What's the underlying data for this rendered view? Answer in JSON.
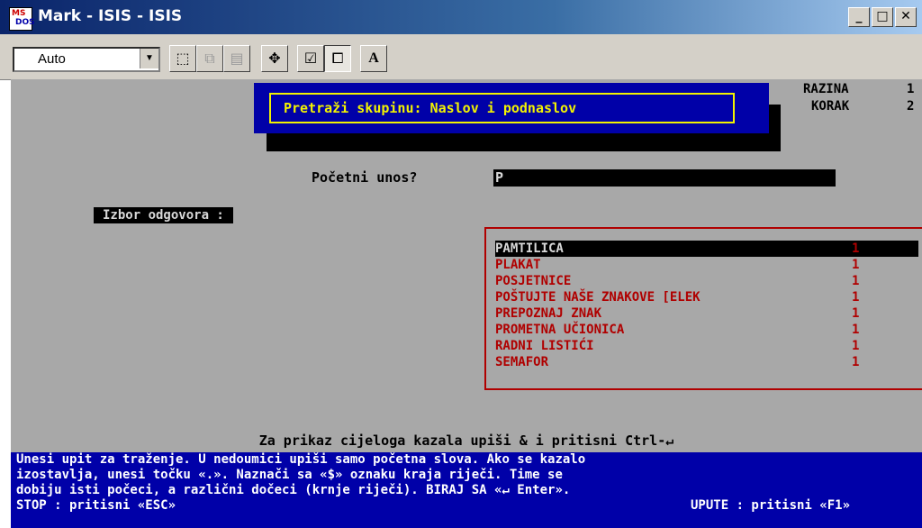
{
  "window": {
    "title": "Mark - ISIS - ISIS",
    "logo_top": "MS",
    "logo_bottom": "DOS",
    "minimize": "_",
    "maximize": "□",
    "close": "✕"
  },
  "toolbar": {
    "font_select_value": "Auto",
    "font_bold_label": "A"
  },
  "popup": {
    "title": "Pretraži skupinu: Naslov i podnaslov"
  },
  "status": {
    "razina_label": "RAZINA",
    "razina_value": "1",
    "korak_label": "KORAK",
    "korak_value": "2"
  },
  "prompt": {
    "label": "Početni unos?",
    "value": "P"
  },
  "izbor_label": "Izbor odgovora :",
  "results": [
    {
      "title": "PAMTILICA",
      "count": "1"
    },
    {
      "title": "PLAKAT",
      "count": "1"
    },
    {
      "title": "POSJETNICE",
      "count": "1"
    },
    {
      "title": "POŠTUJTE NAŠE ZNAKOVE [ELEK",
      "count": "1"
    },
    {
      "title": "PREPOZNAJ ZNAK",
      "count": "1"
    },
    {
      "title": "PROMETNA UČIONICA",
      "count": "1"
    },
    {
      "title": "RADNI LISTIĆI",
      "count": "1"
    },
    {
      "title": "SEMAFOR",
      "count": "1"
    }
  ],
  "hint": "Za prikaz cijeloga kazala upiši & i pritisni Ctrl-↵",
  "help": {
    "line1": "Unesi upit za traženje. U nedoumici upiši samo početna slova. Ako se kazalo",
    "line2": "izostavlja, unesi točku «.». Naznači sa «$» oznaku kraja riječi. Time se",
    "line3": "dobiju isti počeci, a različni dočeci (krnje riječi). BIRAJ SA «↵ Enter».",
    "stop": "STOP : pritisni «ESC»",
    "upute": "UPUTE : pritisni «F1»"
  },
  "colors": {
    "dos_bg": "#a8a8a8",
    "dos_blue": "#0000a8",
    "dos_red": "#b00000",
    "dos_yellow": "#f2f200"
  }
}
